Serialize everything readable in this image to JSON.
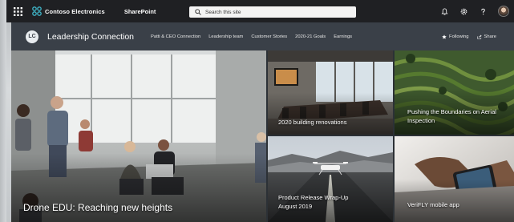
{
  "suite_bar": {
    "brand_name": "Contoso Electronics",
    "app_name": "SharePoint",
    "search_placeholder": "Search this site"
  },
  "site_header": {
    "logo_initials": "LC",
    "title": "Leadership Connection",
    "nav_items": [
      "Patti & CEO Connection",
      "Leadership team",
      "Customer Stories",
      "2020-21 Goals",
      "Earnings"
    ],
    "following_label": "Following",
    "share_label": "Share"
  },
  "hero": {
    "tiles": [
      {
        "title": "Drone EDU: Reaching new heights"
      },
      {
        "title": "2020 building renovations"
      },
      {
        "title": "Pushing the Boundaries on Aerial Inspection"
      },
      {
        "title_line1": "Product Release Wrap-Up",
        "title_line2": "August 2019"
      },
      {
        "title": "VeriFLY mobile app"
      }
    ]
  },
  "colors": {
    "suite_bar_bg": "#1f2023",
    "site_header_bg": "#3a4048",
    "accent": "#ffffff"
  }
}
